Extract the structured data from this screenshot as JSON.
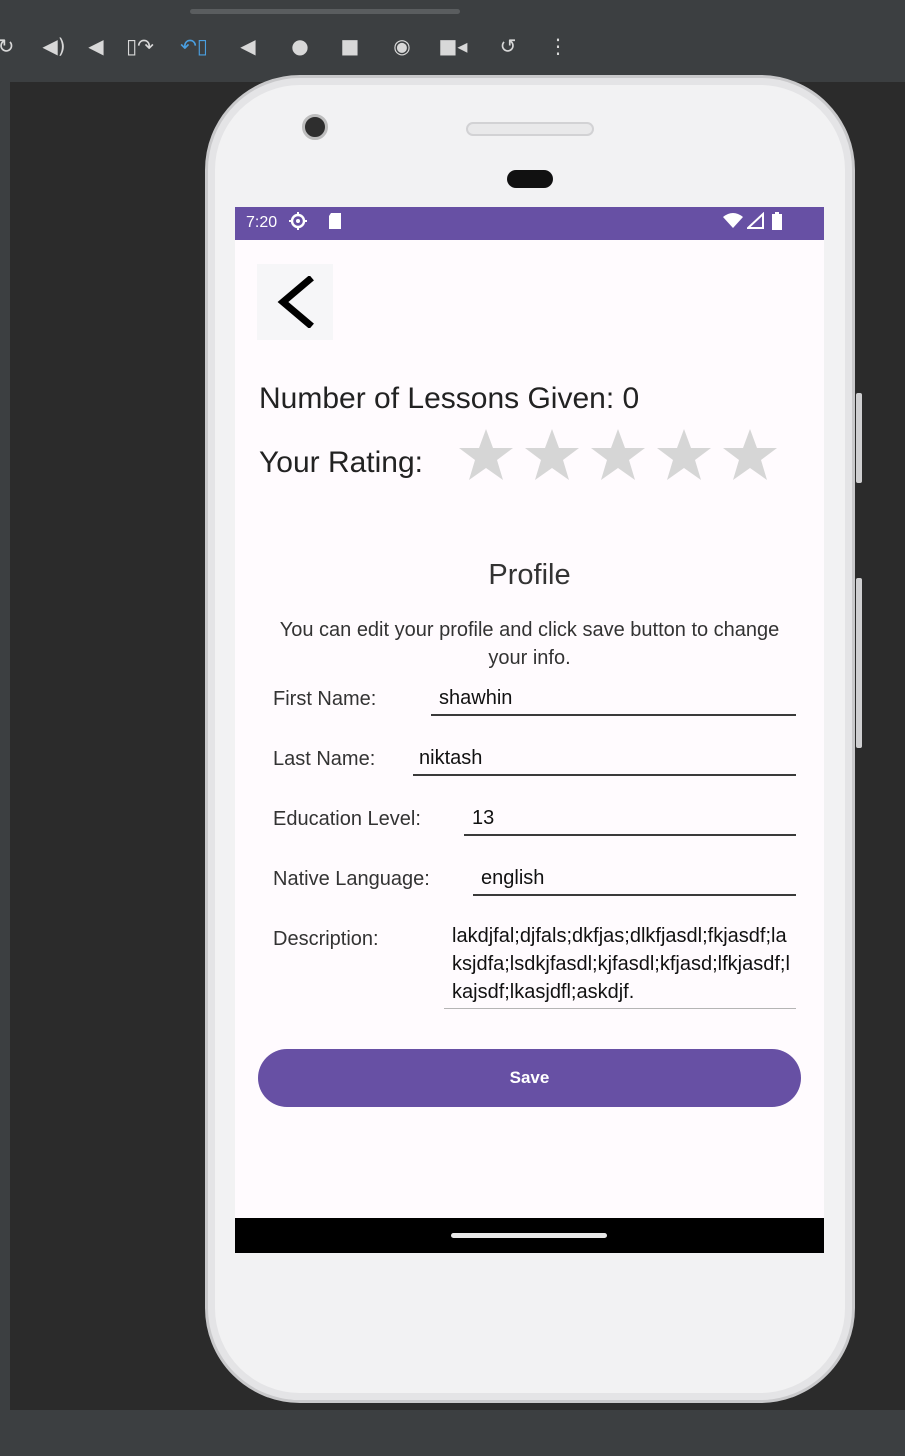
{
  "toolbar": {
    "icons": [
      "rotate-icon",
      "volume-up-icon",
      "volume-down-icon",
      "rotate-right-icon",
      "rotate-left-icon",
      "back-icon",
      "home-icon",
      "overview-icon",
      "camera-icon",
      "record-icon",
      "undo-icon",
      "more-icon"
    ],
    "glyphs": {
      "rotate": "↻",
      "vol_up": "◀)",
      "vol_down": "◀",
      "rot_right": "▯↷",
      "rot_left": "↶▯",
      "back": "◀",
      "home": "●",
      "overview": "■",
      "camera": "◉",
      "record": "■◂",
      "undo": "↺",
      "more": "⋮"
    }
  },
  "status_bar": {
    "time": "7:20",
    "icons": [
      "settings-status-icon",
      "sd-card-icon",
      "wifi-icon",
      "signal-icon",
      "battery-icon"
    ],
    "color": "#6750a4"
  },
  "screen": {
    "back_label": "back",
    "lessons_text": "Number of Lessons Given: 0",
    "rating_label": "Your Rating:",
    "rating_value": 0,
    "rating_max": 5,
    "profile_title": "Profile",
    "profile_desc": "You can edit your profile and click save button to change your info.",
    "fields": {
      "first_name_label": "First Name:",
      "first_name_value": "shawhin",
      "last_name_label": "Last Name:",
      "last_name_value": "niktash",
      "education_label": "Education Level:",
      "education_value": "13",
      "language_label": "Native Language:",
      "language_value": "english",
      "description_label": "Description:",
      "description_value": "lakdjfal;djfals;dkfjas;dlkfjasdl;fkjasdf;laksjdfa;lsdkjfasdl;kjfasdl;kfjasd;lfkjasdf;lkajsdf;lkasjdfl;askdjf."
    },
    "save_label": "Save",
    "accent": "#6750a4",
    "star_color": "#d6d6d6"
  }
}
